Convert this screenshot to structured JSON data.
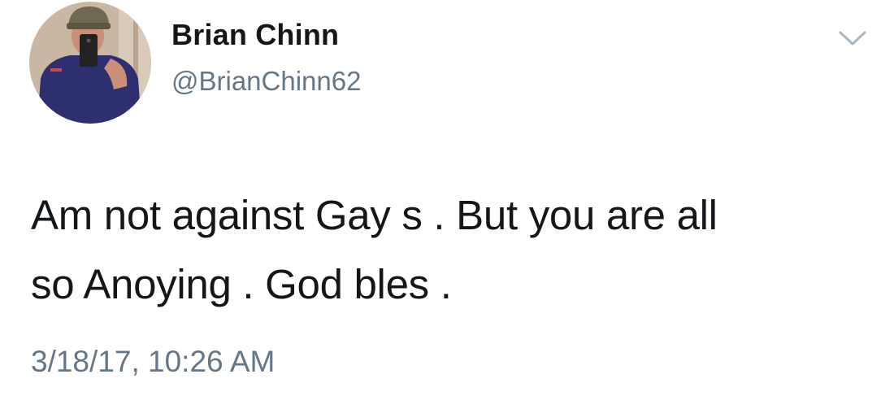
{
  "user": {
    "display_name": "Brian Chinn",
    "handle": "@BrianChinn62"
  },
  "tweet": {
    "text": "Am not against Gay s . But you are all\nso Anoying . God bles .",
    "timestamp": "3/18/17, 10:26 AM"
  },
  "icons": {
    "menu": "chevron-down-icon",
    "avatar": "profile-photo"
  },
  "colors": {
    "text_primary": "#14171a",
    "text_secondary": "#657786",
    "caret": "#aab8c2",
    "background": "#ffffff"
  }
}
